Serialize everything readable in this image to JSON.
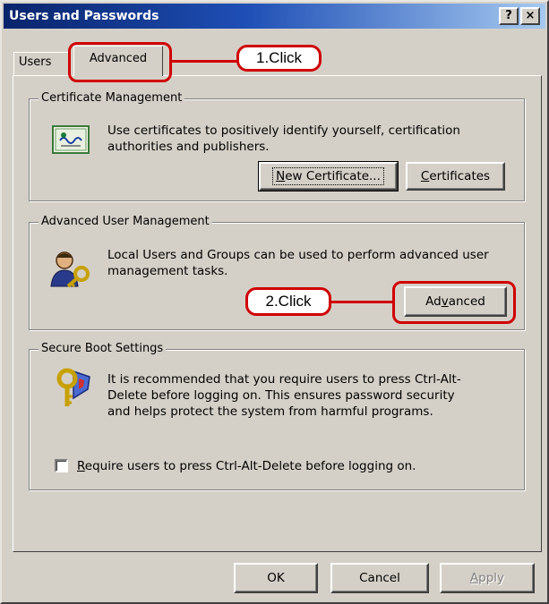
{
  "window": {
    "title": "Users and Passwords",
    "help_button": "?",
    "close_button": "×"
  },
  "tabs": {
    "users": "Users",
    "advanced": "Advanced"
  },
  "callouts": {
    "step1": "1.Click",
    "step2": "2.Click"
  },
  "certificate_management": {
    "legend": "Certificate Management",
    "description": "Use certificates to positively identify yourself, certification authorities and publishers.",
    "new_certificate_button": {
      "prefix": "",
      "mnemonic": "N",
      "rest": "ew Certificate..."
    },
    "certificates_button": {
      "prefix": "",
      "mnemonic": "C",
      "rest": "ertificates"
    }
  },
  "advanced_user_management": {
    "legend": "Advanced User Management",
    "description": "Local Users and Groups can be used to perform advanced user management tasks.",
    "advanced_button": {
      "prefix": "Ad",
      "mnemonic": "v",
      "rest": "anced"
    }
  },
  "secure_boot": {
    "legend": "Secure Boot Settings",
    "description": "It is recommended that you require users to press Ctrl-Alt-Delete before logging on. This ensures password security and helps protect the system from harmful programs.",
    "checkbox": {
      "prefix": "",
      "mnemonic": "R",
      "rest": "equire users to press Ctrl-Alt-Delete before logging on."
    },
    "checkbox_checked": false
  },
  "footer": {
    "ok": "OK",
    "cancel": "Cancel",
    "apply": {
      "prefix": "",
      "mnemonic": "A",
      "rest": "pply"
    }
  },
  "colors": {
    "dialog_bg": "#d4d0c8",
    "title_start": "#08246b",
    "title_end": "#a6caf0",
    "callout_red": "#d00000"
  },
  "icons": {
    "certificate": "certificate-icon",
    "users": "users-key-icon",
    "secure_boot": "key-shield-icon"
  }
}
